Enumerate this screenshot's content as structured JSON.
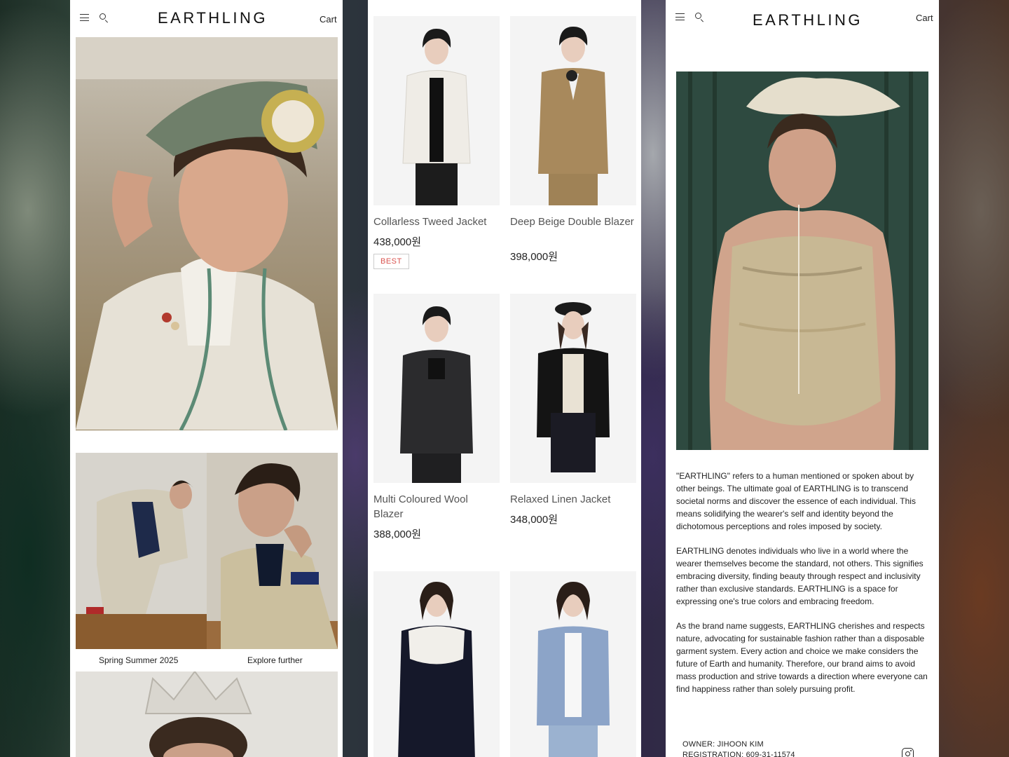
{
  "left": {
    "logo": "EARTHLING",
    "cart": "Cart",
    "captions": [
      "Spring Summer 2025",
      "Explore further"
    ]
  },
  "grid": {
    "products": [
      {
        "name": "Collarless Tweed Jacket",
        "price": "438,000원",
        "badge": "BEST"
      },
      {
        "name": "Deep Beige Double Blazer",
        "price": "398,000원",
        "badge": ""
      },
      {
        "name": "Multi Coloured Wool Blazer",
        "price": "388,000원",
        "badge": ""
      },
      {
        "name": "Relaxed Linen Jacket",
        "price": "348,000원",
        "badge": ""
      }
    ]
  },
  "right": {
    "logo": "EARTHLING",
    "cart": "Cart",
    "paragraphs": [
      "\"EARTHLING\" refers to a human mentioned or spoken about by other beings. The ultimate goal of EARTHLING is to transcend societal norms and discover the essence of each individual. This means solidifying the wearer's self and identity beyond the dichotomous perceptions and roles imposed by society.",
      "EARTHLING denotes individuals who live in a world where the wearer themselves become the standard, not others. This signifies embracing diversity, finding beauty through respect and inclusivity rather than exclusive standards. EARTHLING is a space for expressing one's true colors and embracing freedom.",
      "As the brand name suggests, EARTHLING cherishes and respects nature, advocating for sustainable fashion rather than a disposable garment system. Every action and choice we make considers the future of Earth and humanity. Therefore, our brand aims to avoid mass production and strive towards a direction where everyone can find happiness rather than solely pursuing profit."
    ],
    "owner": "OWNER: JIHOON KIM",
    "registration": "REGISTRATION: 609-31-11574"
  },
  "colors": {
    "badge": "#d9534f",
    "text": "#222222",
    "muted": "#555555"
  }
}
